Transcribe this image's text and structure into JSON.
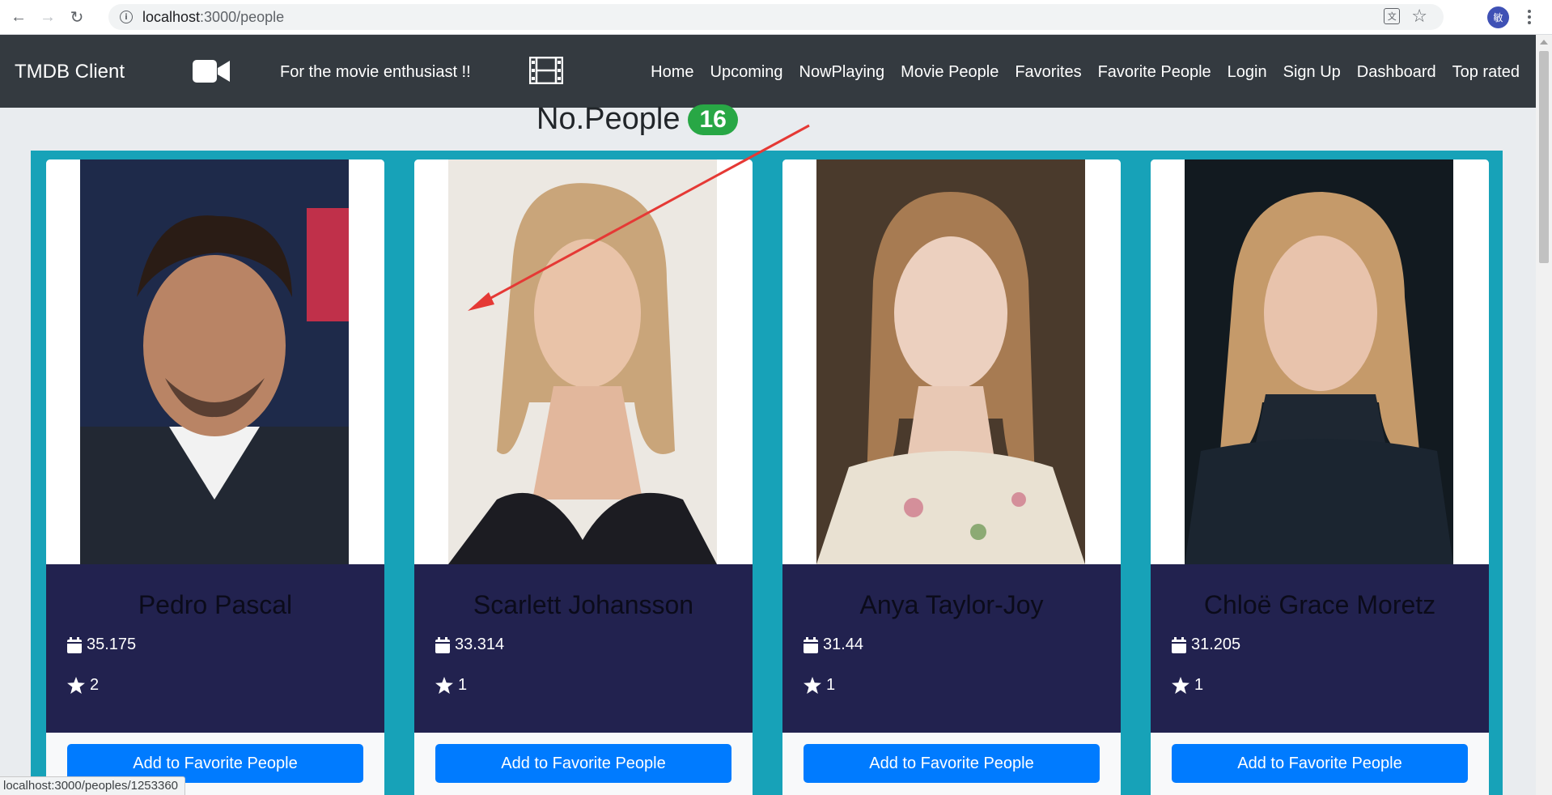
{
  "browser": {
    "url_host": "localhost",
    "url_path": ":3000/people",
    "profile_initial": "敏",
    "status_url": "localhost:3000/peoples/1253360"
  },
  "navbar": {
    "brand": "TMDB Client",
    "tagline": "For the movie enthusiast !!",
    "links": [
      "Home",
      "Upcoming",
      "NowPlaying",
      "Movie People",
      "Favorites",
      "Favorite People",
      "Login",
      "Sign Up",
      "Dashboard",
      "Top rated"
    ]
  },
  "heading": {
    "title": "No.People",
    "count": "16"
  },
  "people": [
    {
      "name": "Pedro Pascal",
      "popularity": "35.175",
      "likes": "2",
      "button": "Add to Favorite People"
    },
    {
      "name": "Scarlett Johansson",
      "popularity": "33.314",
      "likes": "1",
      "button": "Add to Favorite People"
    },
    {
      "name": "Anya Taylor-Joy",
      "popularity": "31.44",
      "likes": "1",
      "button": "Add to Favorite People"
    },
    {
      "name": "Chloë Grace Moretz",
      "popularity": "31.205",
      "likes": "1",
      "button": "Add to Favorite People"
    }
  ],
  "colors": {
    "navbar_bg": "#343a40",
    "grid_bg": "#17a2b8",
    "card_info_bg": "#22224f",
    "badge_green": "#28a745",
    "button_blue": "#007bff",
    "annotation_red": "#e53935"
  },
  "icons": [
    "back-arrow-icon",
    "forward-arrow-icon",
    "reload-icon",
    "info-icon",
    "translate-icon",
    "bookmark-star-icon",
    "video-camera-icon",
    "film-strip-icon",
    "calendar-icon",
    "star-icon"
  ]
}
